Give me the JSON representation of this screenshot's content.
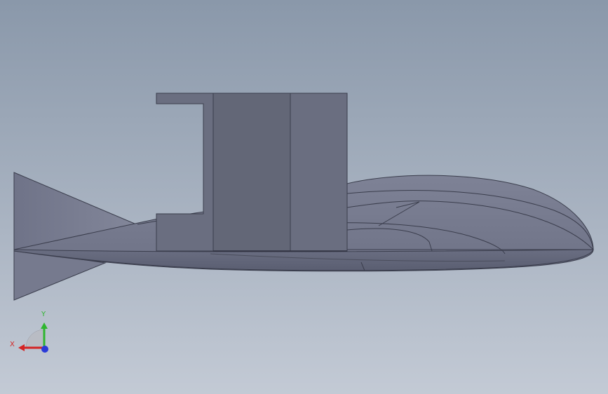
{
  "viewport": {
    "background_top": "#8a98aa",
    "background_bottom": "#c3cad5"
  },
  "model": {
    "body_color": "#7b7f93",
    "shadow_color": "#5e6173",
    "block_color": "#636777",
    "edge_color": "#3a3d4c"
  },
  "triad": {
    "x_label": "X",
    "y_label": "Y",
    "x_color": "#d42424",
    "y_color": "#2fb62f",
    "z_color": "#2a3ad8"
  }
}
